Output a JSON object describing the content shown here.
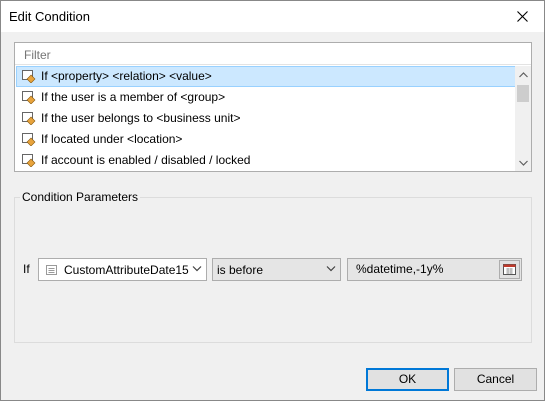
{
  "window": {
    "title": "Edit Condition"
  },
  "filter": {
    "placeholder": "Filter"
  },
  "conditions": [
    {
      "label": "If <property> <relation> <value>",
      "selected": true
    },
    {
      "label": "If the user is a member of <group>",
      "selected": false
    },
    {
      "label": "If the user belongs to <business unit>",
      "selected": false
    },
    {
      "label": "If located under <location>",
      "selected": false
    },
    {
      "label": "If account is enabled / disabled / locked",
      "selected": false
    }
  ],
  "parameters": {
    "group_label": "Condition Parameters",
    "if_label": "If",
    "attribute": "CustomAttributeDate15",
    "relation": "is before",
    "value": "%datetime,-1y%"
  },
  "buttons": {
    "ok": "OK",
    "cancel": "Cancel"
  },
  "colors": {
    "selection": "#cce8ff",
    "accent": "#0078d7",
    "icon_orange": "#e8a33c"
  }
}
